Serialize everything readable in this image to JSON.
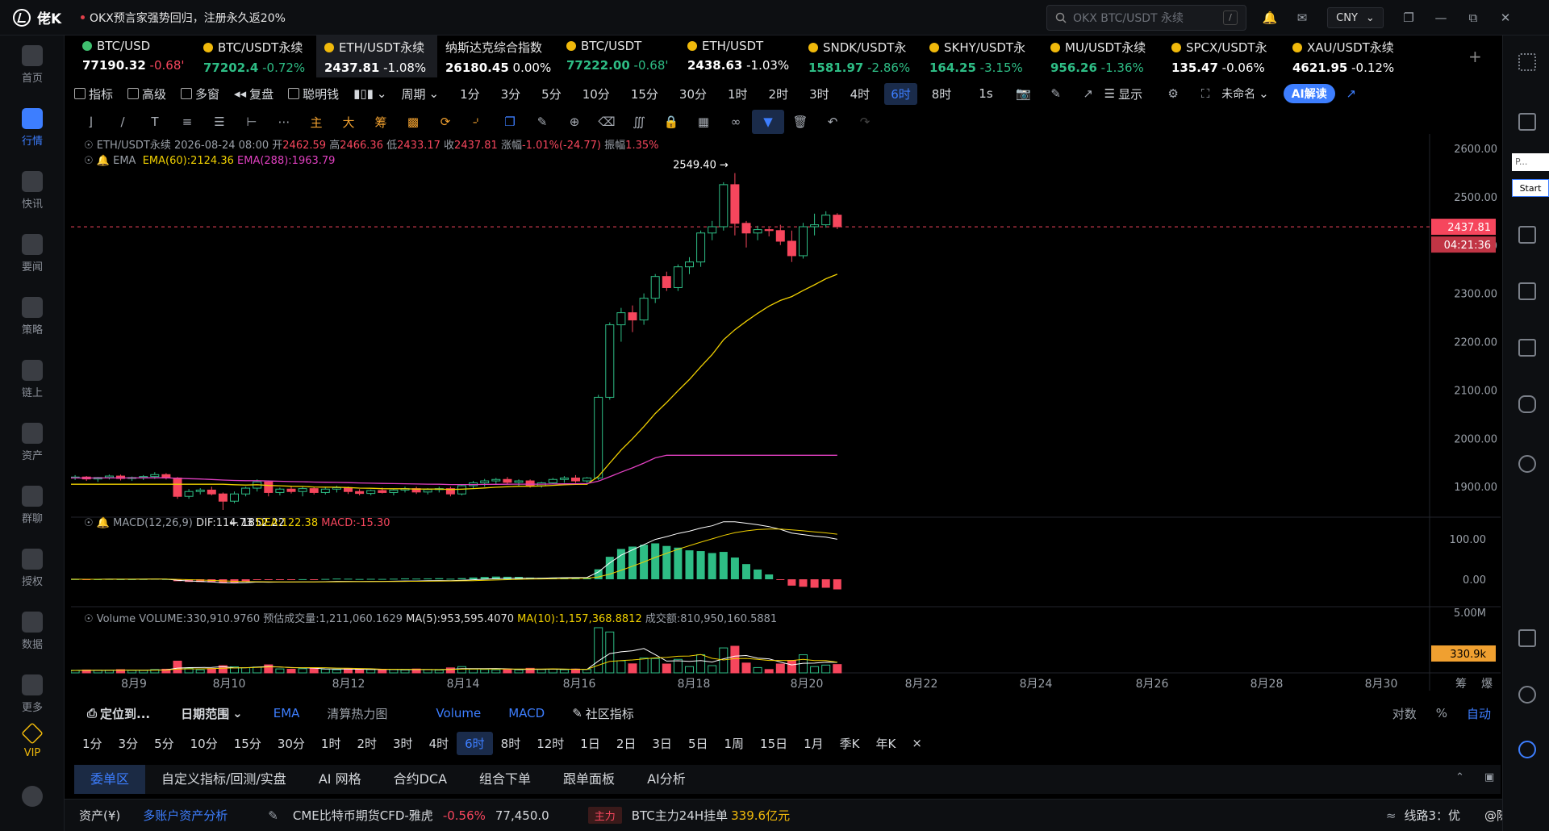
{
  "app": {
    "name": "佬K",
    "announcement": "OKX预言家强势回归，注册永久返20%"
  },
  "search": {
    "placeholder": "OKX BTC/USDT 永续",
    "shortcut": "/"
  },
  "currency": "CNY",
  "sidebar": [
    {
      "label": "首页",
      "icon": "home-icon"
    },
    {
      "label": "行情",
      "icon": "chart-icon",
      "active": true
    },
    {
      "label": "快讯",
      "icon": "news-icon"
    },
    {
      "label": "要闻",
      "icon": "article-icon"
    },
    {
      "label": "策略",
      "icon": "strategy-icon"
    },
    {
      "label": "链上",
      "icon": "chain-icon"
    },
    {
      "label": "资产",
      "icon": "wallet-icon"
    },
    {
      "label": "群聊",
      "icon": "chat-icon"
    },
    {
      "label": "授权",
      "icon": "key-icon"
    },
    {
      "label": "数据",
      "icon": "data-icon"
    },
    {
      "label": "更多",
      "icon": "more-icon"
    },
    {
      "label": "VIP",
      "icon": "vip-icon"
    }
  ],
  "symbol_tabs": [
    {
      "name": "BTC/USD",
      "price": "77190.32",
      "change": "-0.68'",
      "dir": "dn",
      "icon": "g"
    },
    {
      "name": "BTC/USDT永续",
      "price": "77202.4",
      "change": "-0.72%",
      "dir": "up",
      "icon": "y"
    },
    {
      "name": "ETH/USDT永续",
      "price": "2437.81",
      "change": "-1.08%",
      "dir": "wh",
      "icon": "y",
      "active": true
    },
    {
      "name": "纳斯达克综合指数",
      "price": "26180.45",
      "change": "0.00%",
      "dir": "wh",
      "icon": ""
    },
    {
      "name": "BTC/USDT",
      "price": "77222.00",
      "change": "-0.68'",
      "dir": "up",
      "icon": "y"
    },
    {
      "name": "ETH/USDT",
      "price": "2438.63",
      "change": "-1.03%",
      "dir": "wh",
      "icon": "y"
    },
    {
      "name": "SNDK/USDT永",
      "price": "1581.97",
      "change": "-2.86%",
      "dir": "up",
      "icon": "y"
    },
    {
      "name": "SKHY/USDT永",
      "price": "164.25",
      "change": "-3.15%",
      "dir": "up",
      "icon": "y"
    },
    {
      "name": "MU/USDT永续",
      "price": "956.26",
      "change": "-1.36%",
      "dir": "up",
      "icon": "y"
    },
    {
      "name": "SPCX/USDT永",
      "price": "135.47",
      "change": "-0.06%",
      "dir": "wh",
      "icon": "y"
    },
    {
      "name": "XAU/USDT永续",
      "price": "4621.95",
      "change": "-0.12%",
      "dir": "wh",
      "icon": "y"
    }
  ],
  "toolbar": {
    "indicators": "指标",
    "advanced": "高级",
    "multi_window": "多窗",
    "replay": "复盘",
    "smart_money": "聪明钱",
    "period": "周期",
    "timeframes": [
      "1分",
      "3分",
      "5分",
      "10分",
      "15分",
      "30分",
      "1时",
      "2时",
      "3时",
      "4时",
      "6时",
      "8时"
    ],
    "active_tf": "6时",
    "one_sec": "1s",
    "display": "显示",
    "unnamed": "未命名",
    "ai": "AI解读"
  },
  "legend": {
    "symbol_line": "ETH/USDT永续",
    "date": "2026-08-24 08:00",
    "open_k": "开",
    "open": "2462.59",
    "high_k": "高",
    "high": "2466.36",
    "low_k": "低",
    "low": "2433.17",
    "close_k": "收",
    "close": "2437.81",
    "chg_k": "涨幅",
    "chg": "-1.01%(-24.77)",
    "amp_k": "振幅",
    "amp": "1.35%",
    "ema_label": "EMA",
    "ema60": "EMA(60):2124.36",
    "ema288": "EMA(288):1963.79",
    "macd_label": "MACD(12,26,9)",
    "dif": "DIF:114.73",
    "dea": "DEA:122.38",
    "macd": "MACD:-15.30",
    "vol_label": "Volume",
    "vol": "VOLUME:330,910.9760",
    "est": "预估成交量:1,211,060.1629",
    "ma5": "MA(5):953,595.4070",
    "ma10": "MA(10):1,157,368.8812",
    "amount": "成交额:810,950,160.5881"
  },
  "chart_data": {
    "type": "candlestick",
    "interval": "6时",
    "price_axis": [
      "2600.00",
      "2500.00",
      "2400.00",
      "2300.00",
      "2200.00",
      "2100.00",
      "2000.00",
      "1900.00"
    ],
    "price_range": [
      1862,
      2630
    ],
    "last_price": "2437.81",
    "countdown": "04:21:36",
    "high_marker": "2549.40",
    "low_marker": "1852.22",
    "x_labels": [
      "8月9",
      "8月10",
      "8月12",
      "8月14",
      "8月16",
      "8月18",
      "8月20",
      "8月22",
      "8月24",
      "8月26",
      "8月28",
      "8月30"
    ],
    "macd_axis": [
      "100.00",
      "0.00"
    ],
    "vol_axis": [
      "5.00M"
    ],
    "vol_last": "330.9k",
    "candles": [
      [
        1920,
        1922,
        1915,
        1918
      ],
      [
        1918,
        1924,
        1914,
        1920
      ],
      [
        1920,
        1922,
        1912,
        1916
      ],
      [
        1916,
        1920,
        1910,
        1919
      ],
      [
        1919,
        1925,
        1915,
        1922
      ],
      [
        1922,
        1925,
        1913,
        1917
      ],
      [
        1917,
        1921,
        1912,
        1919
      ],
      [
        1919,
        1924,
        1914,
        1921
      ],
      [
        1921,
        1930,
        1916,
        1925
      ],
      [
        1925,
        1928,
        1915,
        1918
      ],
      [
        1918,
        1920,
        1875,
        1880
      ],
      [
        1880,
        1895,
        1875,
        1890
      ],
      [
        1890,
        1897,
        1884,
        1893
      ],
      [
        1893,
        1900,
        1882,
        1885
      ],
      [
        1885,
        1888,
        1852,
        1870
      ],
      [
        1870,
        1890,
        1866,
        1885
      ],
      [
        1885,
        1900,
        1880,
        1897
      ],
      [
        1897,
        1915,
        1890,
        1910
      ],
      [
        1910,
        1913,
        1880,
        1888
      ],
      [
        1888,
        1898,
        1882,
        1895
      ],
      [
        1895,
        1902,
        1886,
        1890
      ],
      [
        1890,
        1900,
        1880,
        1896
      ],
      [
        1896,
        1900,
        1884,
        1888
      ],
      [
        1888,
        1898,
        1884,
        1895
      ],
      [
        1895,
        1902,
        1888,
        1898
      ],
      [
        1898,
        1900,
        1885,
        1890
      ],
      [
        1890,
        1895,
        1882,
        1886
      ],
      [
        1886,
        1894,
        1882,
        1892
      ],
      [
        1892,
        1898,
        1886,
        1888
      ],
      [
        1888,
        1895,
        1882,
        1893
      ],
      [
        1893,
        1900,
        1888,
        1896
      ],
      [
        1896,
        1900,
        1885,
        1889
      ],
      [
        1889,
        1897,
        1884,
        1894
      ],
      [
        1894,
        1900,
        1888,
        1896
      ],
      [
        1896,
        1900,
        1880,
        1885
      ],
      [
        1885,
        1905,
        1882,
        1902
      ],
      [
        1902,
        1912,
        1896,
        1908
      ],
      [
        1908,
        1916,
        1900,
        1912
      ],
      [
        1912,
        1918,
        1904,
        1915
      ],
      [
        1915,
        1920,
        1905,
        1909
      ],
      [
        1909,
        1915,
        1902,
        1912
      ],
      [
        1912,
        1915,
        1898,
        1902
      ],
      [
        1902,
        1910,
        1898,
        1908
      ],
      [
        1908,
        1918,
        1905,
        1915
      ],
      [
        1915,
        1922,
        1908,
        1918
      ],
      [
        1918,
        1924,
        1908,
        1912
      ],
      [
        1912,
        1920,
        1908,
        1918
      ],
      [
        1918,
        2090,
        1914,
        2085
      ],
      [
        2085,
        2240,
        2080,
        2235
      ],
      [
        2235,
        2270,
        2200,
        2260
      ],
      [
        2260,
        2275,
        2220,
        2245
      ],
      [
        2245,
        2300,
        2235,
        2290
      ],
      [
        2290,
        2340,
        2280,
        2335
      ],
      [
        2335,
        2345,
        2305,
        2312
      ],
      [
        2312,
        2360,
        2305,
        2355
      ],
      [
        2355,
        2375,
        2340,
        2365
      ],
      [
        2365,
        2430,
        2355,
        2425
      ],
      [
        2425,
        2450,
        2410,
        2438
      ],
      [
        2438,
        2530,
        2430,
        2525
      ],
      [
        2525,
        2549,
        2420,
        2445
      ],
      [
        2445,
        2450,
        2395,
        2425
      ],
      [
        2425,
        2440,
        2410,
        2432
      ],
      [
        2432,
        2436,
        2418,
        2430
      ],
      [
        2430,
        2442,
        2400,
        2408
      ],
      [
        2408,
        2430,
        2365,
        2378
      ],
      [
        2378,
        2446,
        2372,
        2438
      ],
      [
        2438,
        2465,
        2420,
        2442
      ],
      [
        2442,
        2470,
        2436,
        2462
      ],
      [
        2462,
        2466,
        2433,
        2438
      ]
    ]
  },
  "bottom_toolbar": {
    "locate": "定位到...",
    "date_range": "日期范围",
    "ind1": "EMA",
    "ind2": "清算热力图",
    "ind3": "Volume",
    "ind4": "MACD",
    "community": "社区指标",
    "log": "对数",
    "pct": "%",
    "auto": "自动",
    "timeframes": [
      "1分",
      "3分",
      "5分",
      "10分",
      "15分",
      "30分",
      "1时",
      "2时",
      "3时",
      "4时",
      "6时",
      "8时",
      "12时",
      "1日",
      "2日",
      "3日",
      "5日",
      "1周",
      "15日",
      "1月",
      "季K",
      "年K"
    ],
    "active_tf": "6时",
    "close": "×",
    "axis_corner_1": "筹",
    "axis_corner_2": "爆"
  },
  "bottom_tabs": [
    "委单区",
    "自定义指标/回测/实盘",
    "AI 网格",
    "合约DCA",
    "组合下单",
    "跟单面板",
    "AI分析"
  ],
  "status": {
    "assets": "资产(¥)",
    "multi": "多账户资产分析",
    "ticker": "CME比特币期货CFD-雅虎",
    "ticker_chg": "-0.56%",
    "ticker_px": "77,450.0",
    "main_badge": "主力",
    "main_text": "BTC主力24H挂单",
    "main_val": "339.6亿元",
    "line": "线路3：优",
    "watermark": "@陈大炮"
  },
  "right_panel": {
    "p_label": "P...",
    "start": "Start"
  }
}
